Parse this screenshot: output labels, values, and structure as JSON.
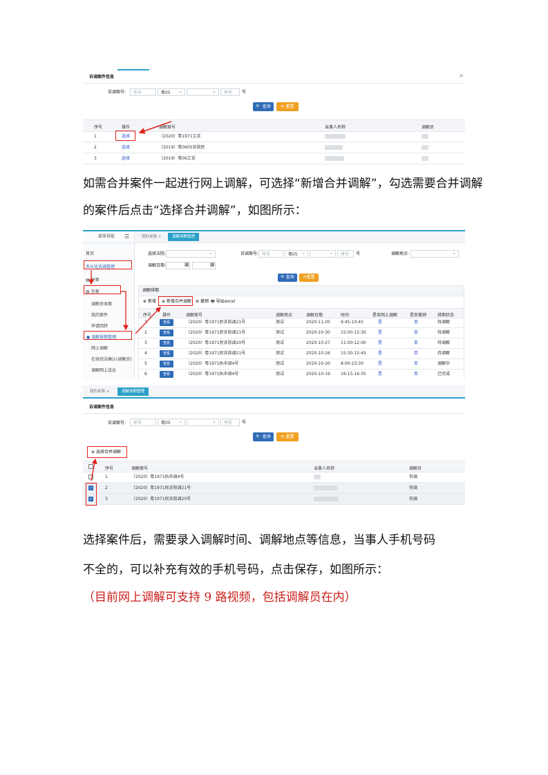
{
  "shot1": {
    "title": "诉调案件信息",
    "close": "×",
    "query_label": "诉调案号:",
    "year_ph": "年号",
    "court_val": "粤05",
    "seq_ph": "序号",
    "hao": "号",
    "search_btn": "查询",
    "reset_btn": "重置",
    "headers": [
      "序号",
      "操作",
      "调解案号",
      "当事人名称",
      "调解员"
    ],
    "rows": [
      {
        "no": "1",
        "op": "选择",
        "case": "（2020）粤1971工诉"
      },
      {
        "no": "2",
        "op": "选择",
        "case": "（2019）粤0605诉前民"
      },
      {
        "no": "3",
        "op": "选择",
        "case": "（2019）粤06工诉"
      }
    ]
  },
  "para1_line1": "如需合并案件一起进行网上调解，可选择“新增合并调解”，勾选需要合并调解",
  "para1_line2": "的案件后点击“选择合并调解”，如图所示：",
  "shot2": {
    "nav_title": "菜单导航",
    "tab_home": "我的桌面",
    "tab_active": "调解排期管理",
    "side": [
      "首页",
      "多元化诉调管理",
      "分案",
      "办案",
      "调解员收案",
      "我的案件",
      "申请回转",
      "调解排期管理",
      "网上调解",
      "在线司法确认(调解员)",
      "调解网上送达"
    ],
    "f_court": "选择法院:",
    "f_case": "诉调案号:",
    "f_year": "年号",
    "f_court_val": "粤05",
    "f_seq": "序号",
    "f_hao": "号",
    "f_place": "调解地点:",
    "f_date": "调解日期:",
    "search_btn": "查询",
    "reset_btn": "重置",
    "panel_title": "调解排期",
    "tool_add": "新增",
    "tool_merge": "新增合并调解",
    "tool_cancel": "撤销",
    "tool_export": "导出excel",
    "headers": [
      "序号",
      "操作",
      "调解案号",
      "调解地点",
      "调解日期",
      "时间",
      "是否网上调解",
      "是否撤销",
      "排期状态"
    ],
    "view": "查看",
    "rows": [
      {
        "no": "1",
        "case": "（2020）粤1971民诉前调21号",
        "place": "测试",
        "date": "2020-11-05",
        "time": "9:45-10:45",
        "online": "是",
        "cancel": "否",
        "status": "待调解"
      },
      {
        "no": "2",
        "case": "（2020）粤1971民诉前调21号",
        "place": "测试",
        "date": "2020-10-30",
        "time": "15:00-15:30",
        "online": "是",
        "cancel": "否",
        "status": "待调解"
      },
      {
        "no": "3",
        "case": "（2020）粤1971民诉前调20号",
        "place": "测试",
        "date": "2020-10-27",
        "time": "11:00-12:00",
        "online": "是",
        "cancel": "否",
        "status": "待调解"
      },
      {
        "no": "4",
        "case": "（2020）粤1971民诉前调21号",
        "place": "测试",
        "date": "2020-10-26",
        "time": "15:30-15:45",
        "online": "是",
        "cancel": "否",
        "status": "待调解"
      },
      {
        "no": "5",
        "case": "（2020）粤1971执中调4号",
        "place": "测试",
        "date": "2020-10-20",
        "time": "8:00-23:30",
        "online": "是",
        "cancel": "否",
        "status": "调解中"
      },
      {
        "no": "6",
        "case": "（2020）粤1971执中调4号",
        "place": "测试",
        "date": "2020-10-19",
        "time": "16:15-16:35",
        "online": "是",
        "cancel": "否",
        "status": "已完成"
      }
    ]
  },
  "shot3": {
    "tab_home": "我的桌面",
    "tab_active": "调解排期管理",
    "title": "诉调案件信息",
    "query_label": "诉调案号:",
    "year_ph": "年号",
    "court_val": "粤05",
    "seq_ph": "序号",
    "hao": "号",
    "search_btn": "查询",
    "reset_btn": "重置",
    "merge_btn": "选择合并调解",
    "headers": [
      "序号",
      "调解案号",
      "当事人名称",
      "调解员"
    ],
    "rows": [
      {
        "no": "1",
        "case": "（2020）粤1971执中调4号",
        "mediator": "何调",
        "checked": false
      },
      {
        "no": "2",
        "case": "（2020）粤1971民诉前调21号",
        "mediator": "何调",
        "checked": true
      },
      {
        "no": "3",
        "case": "（2020）粤1971民诉前调20号",
        "mediator": "何调",
        "checked": true
      }
    ]
  },
  "para2_line1": "选择案件后，需要录入调解时间、调解地点等信息，当事人手机号码",
  "para2_line2": "不全的，可以补充有效的手机号码，点击保存，如图所示：",
  "para2_line3": "（目前网上调解可支持 9 路视频，包括调解员在内）",
  "colors": {
    "accent": "#2f6bb8",
    "tab": "#2aa0c8",
    "highlight": "#e0201a",
    "warn": "#f0a020"
  }
}
